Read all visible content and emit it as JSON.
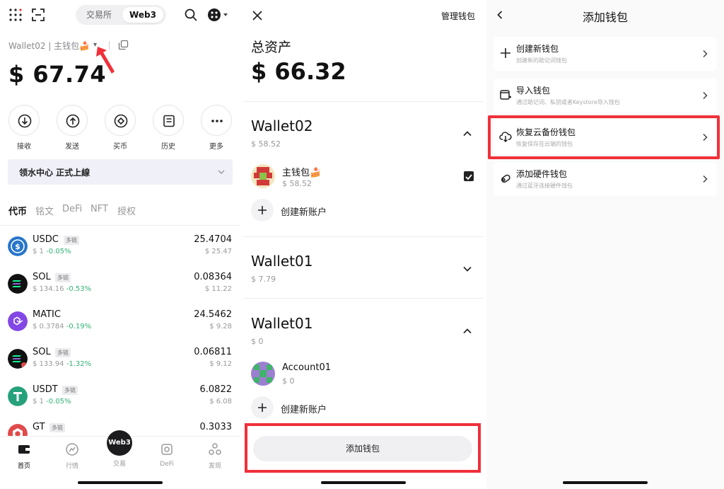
{
  "p1": {
    "seg_exchange": "交易所",
    "seg_web3": "Web3",
    "wallet_label": "Wallet02 | 主钱包🍰",
    "caret": "▾",
    "balance": "$ 67.74",
    "actions": [
      "接收",
      "发送",
      "买币",
      "历史",
      "更多"
    ],
    "promo": "领水中心 正式上線",
    "tabs": [
      "代币",
      "铭文",
      "DeFi",
      "NFT",
      "授权"
    ],
    "tokens": [
      {
        "symbol": "USDC",
        "chip": "多链",
        "price": "$ 1",
        "change": "-0.05%",
        "amount": "25.4704",
        "value": "$ 25.47",
        "color": "#2775ca",
        "icon": "usdc-icon"
      },
      {
        "symbol": "SOL",
        "chip": "多链",
        "price": "$ 134.16",
        "change": "-0.53%",
        "amount": "0.08364",
        "value": "$ 11.22",
        "color": "#111111",
        "icon": "sol-icon"
      },
      {
        "symbol": "MATIC",
        "chip": "",
        "price": "$ 0.3784",
        "change": "-0.19%",
        "amount": "24.5462",
        "value": "$ 9.28",
        "color": "#8247e5",
        "icon": "matic-icon"
      },
      {
        "symbol": "SOL",
        "chip": "多链",
        "price": "$ 133.94",
        "change": "-1.32%",
        "amount": "0.06811",
        "value": "$ 9.12",
        "color": "#111111",
        "icon": "sol-icon"
      },
      {
        "symbol": "USDT",
        "chip": "多链",
        "price": "$ 1",
        "change": "-0.05%",
        "amount": "6.0822",
        "value": "$ 6.08",
        "color": "#26a17b",
        "icon": "usdt-icon"
      },
      {
        "symbol": "GT",
        "chip": "多链",
        "price": "",
        "change": "",
        "amount": "0.3033",
        "value": "",
        "color": "#e04b4b",
        "icon": "gt-icon"
      }
    ],
    "nav": [
      "首页",
      "行情",
      "交易",
      "DeFi",
      "发现"
    ],
    "web3_button": "Web3"
  },
  "p2": {
    "manage": "管理钱包",
    "total_label": "总资产",
    "total": "$ 66.32",
    "groups": [
      {
        "name": "Wallet02",
        "value": "$ 58.52",
        "account": "主钱包🍰",
        "account_value": "$ 58.52",
        "create": "创建新账户"
      },
      {
        "name": "Wallet01",
        "value": "$ 7.79"
      },
      {
        "name": "Wallet01",
        "value": "$ 0",
        "account": "Account01",
        "account_value": "$ 0",
        "create": "创建新账户"
      }
    ],
    "add_wallet": "添加钱包"
  },
  "p3": {
    "title": "添加钱包",
    "options": [
      {
        "title": "创建新钱包",
        "sub": "创建新的助记词钱包"
      },
      {
        "title": "导入钱包",
        "sub": "通过助记词、私钥或者Keystore导入钱包"
      },
      {
        "title": "恢复云备份钱包",
        "sub": "恢复保存在云端的钱包"
      },
      {
        "title": "添加硬件钱包",
        "sub": "通过蓝牙连接硬件钱包"
      }
    ]
  },
  "colors": {
    "accent": "#32b374",
    "highlight": "#f0303a",
    "dark": "#1c1c1e"
  }
}
